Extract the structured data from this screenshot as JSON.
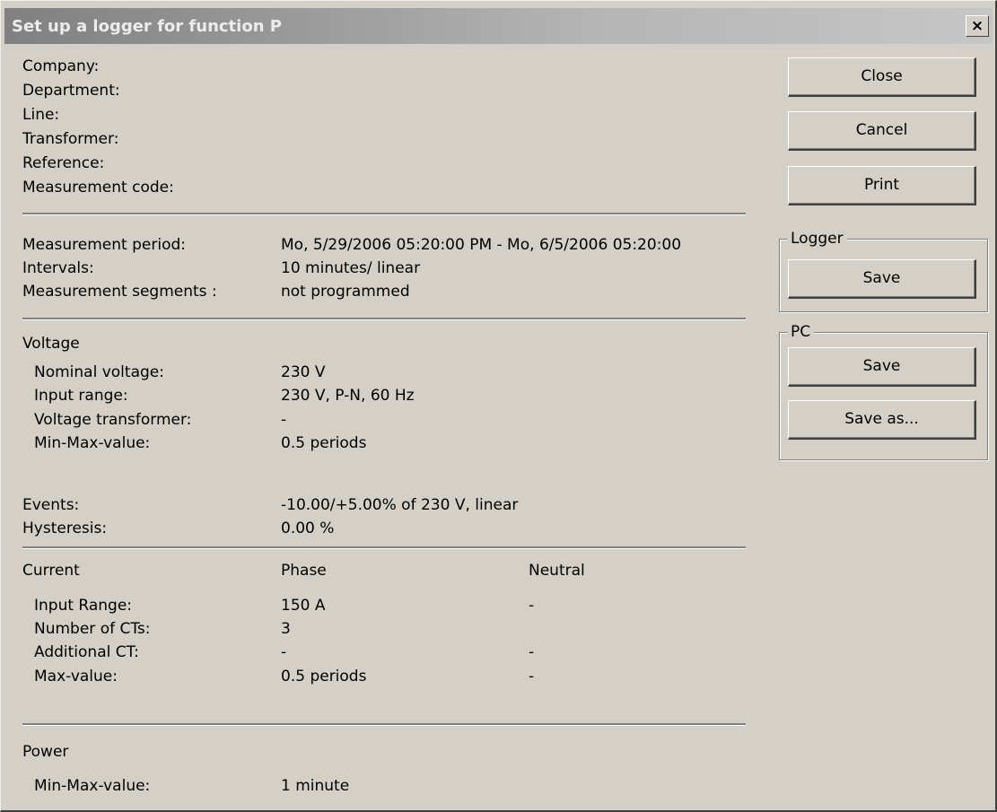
{
  "window": {
    "title": "Set up a logger for function P",
    "close_glyph": "×"
  },
  "header_labels": [
    "Company:",
    "Department:",
    "Line:",
    "Transformer:",
    "Reference:",
    "Measurement code:"
  ],
  "measurement": {
    "period_label": "Measurement period:",
    "period_value": "Mo, 5/29/2006 05:20:00 PM - Mo, 6/5/2006 05:20:00",
    "intervals_label": "Intervals:",
    "intervals_value": "10 minutes/ linear",
    "segments_label": "Measurement segments :",
    "segments_value": "not programmed"
  },
  "voltage": {
    "heading": "Voltage",
    "nominal_label": "Nominal voltage:",
    "nominal_value": "230 V",
    "range_label": "Input range:",
    "range_value": "230 V, P-N, 60 Hz",
    "vt_label": "Voltage transformer:",
    "vt_value": "-",
    "minmax_label": "Min-Max-value:",
    "minmax_value": "0.5 periods",
    "events_label": "Events:",
    "events_value": "-10.00/+5.00% of 230 V, linear",
    "hysteresis_label": "Hysteresis:",
    "hysteresis_value": "0.00 %"
  },
  "current": {
    "heading": "Current",
    "phase_header": "Phase",
    "neutral_header": "Neutral",
    "range_label": "Input Range:",
    "range_phase": "150 A",
    "range_neutral": "-",
    "cts_label": "Number of CTs:",
    "cts_phase": "3",
    "addct_label": "Additional CT:",
    "addct_phase": "-",
    "addct_neutral": "-",
    "max_label": "Max-value:",
    "max_phase": "0.5 periods",
    "max_neutral": "-"
  },
  "power": {
    "heading": "Power",
    "minmax_label": "Min-Max-value:",
    "minmax_value": "1 minute"
  },
  "buttons": {
    "close": "Close",
    "cancel": "Cancel",
    "print": "Print"
  },
  "logger_group": {
    "title": "Logger",
    "save": "Save"
  },
  "pc_group": {
    "title": "PC",
    "save": "Save",
    "save_as": "Save as..."
  }
}
